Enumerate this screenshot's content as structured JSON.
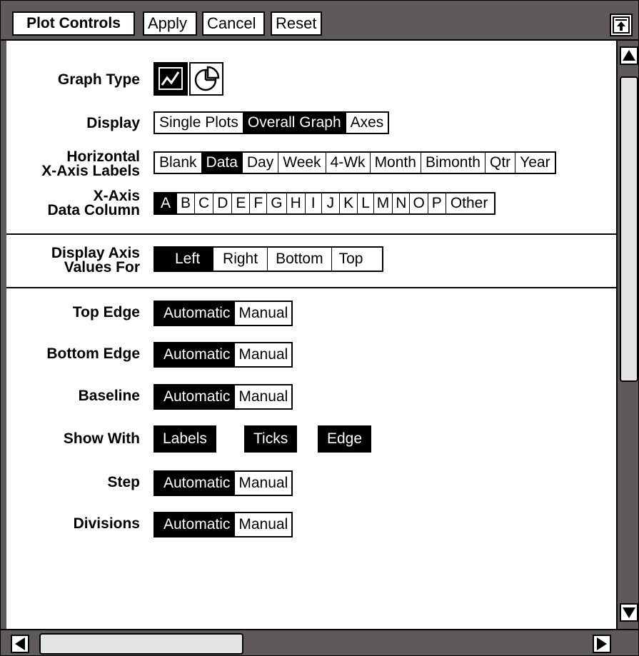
{
  "window": {
    "title": "Plot Controls",
    "buttons": {
      "apply": "Apply",
      "cancel": "Cancel",
      "reset": "Reset"
    }
  },
  "form": {
    "graph_type": {
      "label": "Graph Type",
      "options": [
        "line-chart-icon",
        "pie-chart-icon"
      ],
      "selected": "line-chart-icon"
    },
    "display": {
      "label": "Display",
      "options": [
        "Single Plots",
        "Overall Graph",
        "Axes"
      ],
      "selected": "Overall Graph"
    },
    "x_axis_labels": {
      "label_line1": "Horizontal",
      "label_line2": "X-Axis Labels",
      "options": [
        "Blank",
        "Data",
        "Day",
        "Week",
        "4-Wk",
        "Month",
        "Bimonth",
        "Qtr",
        "Year"
      ],
      "selected": "Data"
    },
    "x_axis_column": {
      "label_line1": "X-Axis",
      "label_line2": "Data Column",
      "options": [
        "A",
        "B",
        "C",
        "D",
        "E",
        "F",
        "G",
        "H",
        "I",
        "J",
        "K",
        "L",
        "M",
        "N",
        "O",
        "P",
        "Other"
      ],
      "selected": "A"
    },
    "display_axis_values": {
      "label_line1": "Display Axis",
      "label_line2": "Values For",
      "options": [
        "Left",
        "Right",
        "Bottom",
        "Top"
      ],
      "selected": "Left"
    },
    "top_edge": {
      "label": "Top Edge",
      "options": [
        "Automatic",
        "Manual"
      ],
      "selected": "Automatic"
    },
    "bottom_edge": {
      "label": "Bottom Edge",
      "options": [
        "Automatic",
        "Manual"
      ],
      "selected": "Automatic"
    },
    "baseline": {
      "label": "Baseline",
      "options": [
        "Automatic",
        "Manual"
      ],
      "selected": "Automatic"
    },
    "show_with": {
      "label": "Show With",
      "options": [
        "Labels",
        "Ticks",
        "Edge"
      ]
    },
    "step": {
      "label": "Step",
      "options": [
        "Automatic",
        "Manual"
      ],
      "selected": "Automatic"
    },
    "divisions": {
      "label": "Divisions",
      "options": [
        "Automatic",
        "Manual"
      ],
      "selected": "Automatic"
    }
  },
  "colors": {
    "frame": "#5f5a59",
    "selected_bg": "#000000",
    "selected_fg": "#ffffff"
  }
}
